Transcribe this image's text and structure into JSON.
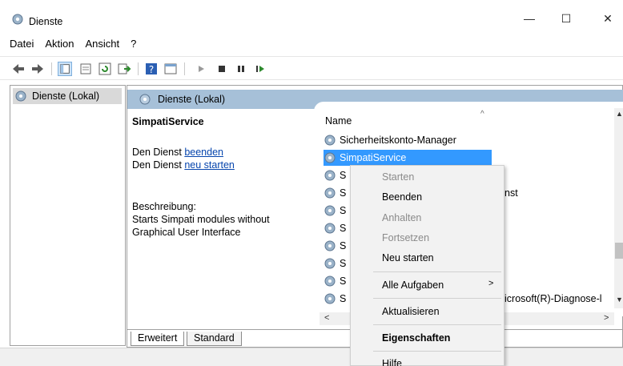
{
  "window": {
    "title": "Dienste"
  },
  "menu": [
    "Datei",
    "Aktion",
    "Ansicht",
    "?"
  ],
  "toolbar": {
    "icons": [
      "back-icon",
      "forward-icon",
      "console-tree-icon",
      "properties-icon",
      "refresh-icon",
      "export-icon",
      "help-icon",
      "details-view-icon",
      "start-icon",
      "stop-icon",
      "pause-icon",
      "restart-icon"
    ]
  },
  "tree": {
    "root": "Dienste (Lokal)"
  },
  "pane_header": "Dienste (Lokal)",
  "details": {
    "service_name": "SimpatiService",
    "stop_prefix": "Den Dienst ",
    "stop_link": "beenden",
    "restart_prefix": "Den Dienst ",
    "restart_link": "neu starten",
    "desc_label": "Beschreibung:",
    "desc_line1": "Starts Simpati modules without",
    "desc_line2": "Graphical User Interface"
  },
  "list": {
    "column": "Name",
    "rows": [
      "Sicherheitskonto-Manager",
      "SimpatiService",
      "S",
      "S",
      "S",
      "S",
      "S",
      "S",
      "S",
      "S"
    ],
    "row4_trailing": "nst",
    "row10_trailing": "icrosoft(R)-Diagnose-l"
  },
  "tabs": [
    "Erweitert",
    "Standard"
  ],
  "context_menu": {
    "items": [
      {
        "label": "Starten",
        "disabled": true
      },
      {
        "label": "Beenden",
        "disabled": false
      },
      {
        "label": "Anhalten",
        "disabled": true
      },
      {
        "label": "Fortsetzen",
        "disabled": true
      },
      {
        "label": "Neu starten",
        "disabled": false
      },
      {
        "label": "Alle Aufgaben",
        "disabled": false,
        "submenu": true
      },
      {
        "label": "Aktualisieren",
        "disabled": false
      },
      {
        "label": "Eigenschaften",
        "disabled": false,
        "bold": true
      },
      {
        "label": "Hilfe",
        "disabled": false
      }
    ]
  },
  "colors": {
    "selection": "#3399ff",
    "header_band": "#a6c0d8",
    "link": "#0645ad"
  }
}
